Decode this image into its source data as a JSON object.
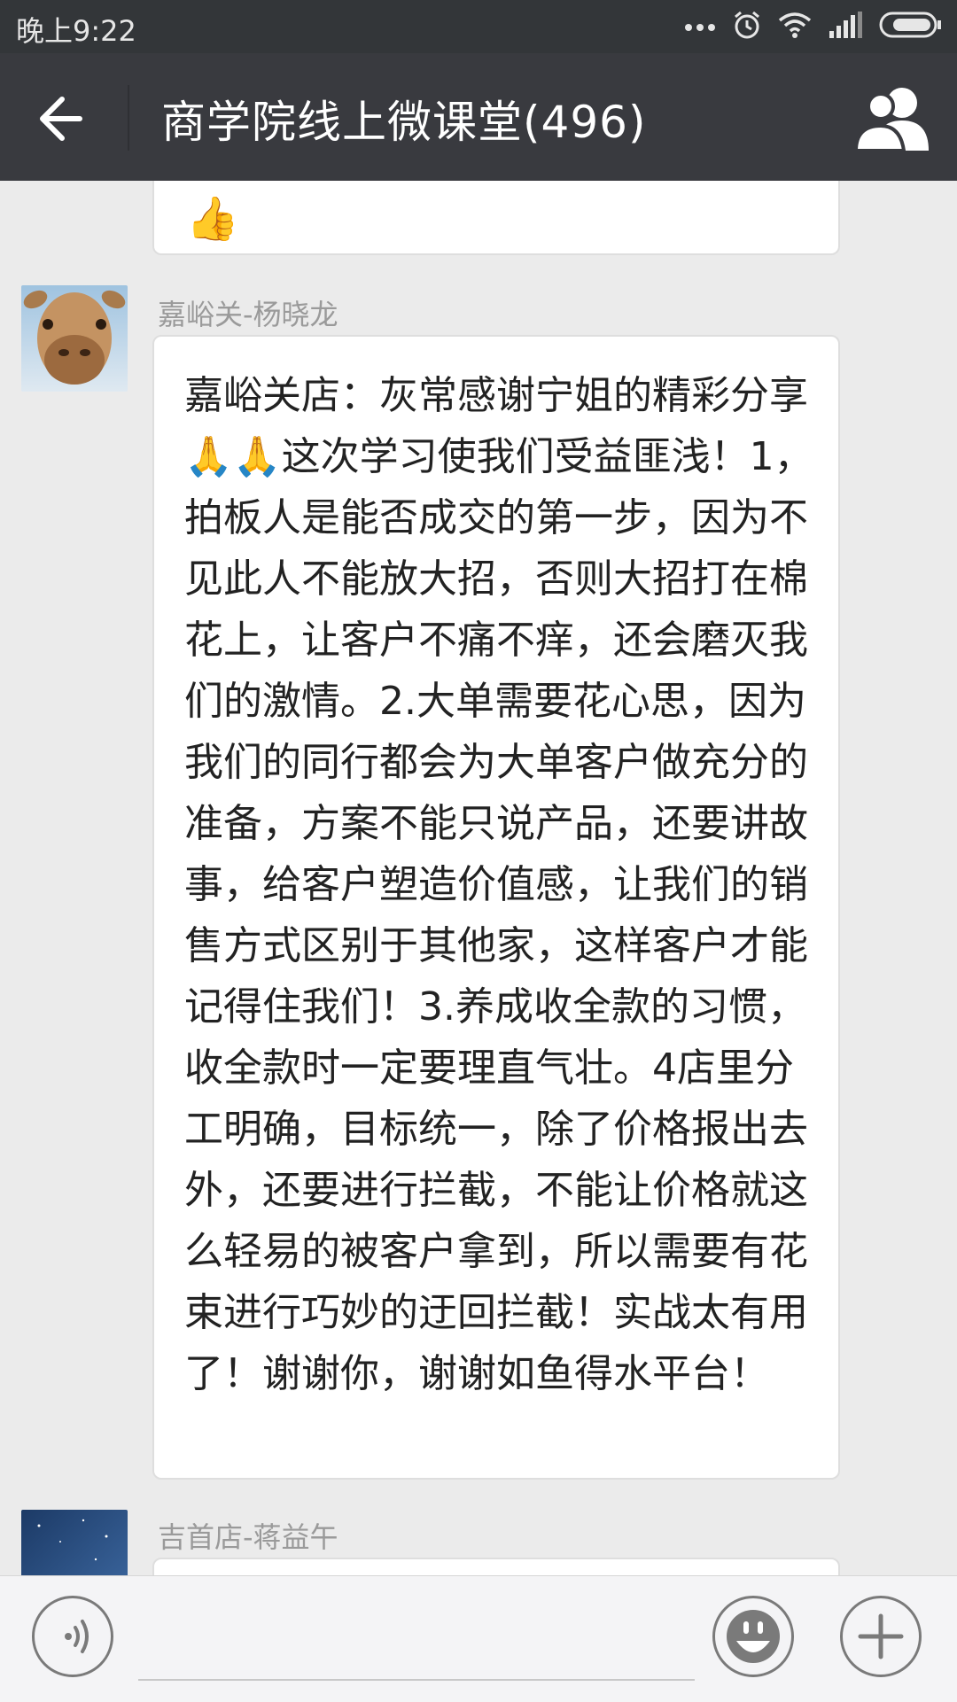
{
  "status_bar": {
    "time": "晚上9:22",
    "icons": [
      "more-dots-icon",
      "alarm-icon",
      "wifi-icon",
      "signal-icon",
      "battery-icon"
    ]
  },
  "header": {
    "title": "商学院线上微课堂(496)",
    "back_icon": "back-arrow-icon",
    "members_icon": "group-members-icon"
  },
  "messages": [
    {
      "emoji": "👍"
    },
    {
      "sender": "嘉峪关-杨晓龙",
      "avatar": "giraffe-avatar",
      "text": "嘉峪关店：灰常感谢宁姐的精彩分享🙏🙏这次学习使我们受益匪浅！1，拍板人是能否成交的第一步，因为不见此人不能放大招，否则大招打在棉花上，让客户不痛不痒，还会磨灭我们的激情。2.大单需要花心思，因为我们的同行都会为大单客户做充分的准备，方案不能只说产品，还要讲故事，给客户塑造价值感，让我们的销售方式区别于其他家，这样客户才能记得住我们！3.养成收全款的习惯，收全款时一定要理直气壮。4店里分工明确，目标统一，除了价格报出去外，还要进行拦截，不能让价格就这么轻易的被客户拿到，所以需要有花束进行巧妙的迂回拦截！实战太有用了！谢谢你，谢谢如鱼得水平台！"
    },
    {
      "sender": "吉首店-蒋益午",
      "avatar": "night-sky-avatar"
    }
  ],
  "input_bar": {
    "voice_icon": "voice-icon",
    "emoji_icon": "emoji-smiley-icon",
    "plus_icon": "plus-icon",
    "placeholder": ""
  }
}
